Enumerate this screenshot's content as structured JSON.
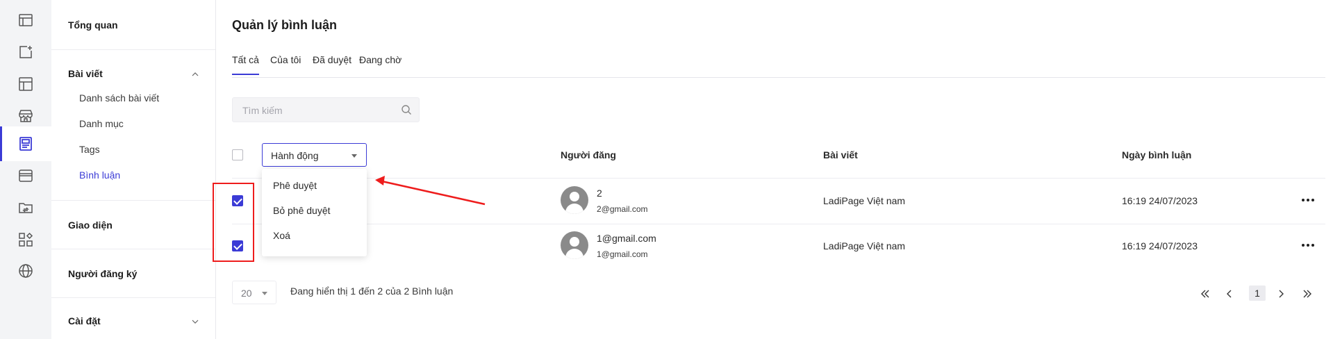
{
  "accent_color": "#3b3bd6",
  "rail": {
    "items": [
      {
        "icon": "dashboard-icon"
      },
      {
        "icon": "add-post-icon"
      },
      {
        "icon": "layout-icon"
      },
      {
        "icon": "store-icon"
      },
      {
        "icon": "blog-icon",
        "active": true
      },
      {
        "icon": "browser-icon"
      },
      {
        "icon": "folder-sync-icon"
      },
      {
        "icon": "apps-icon"
      },
      {
        "icon": "globe-icon"
      }
    ]
  },
  "sidebar": {
    "overview": "Tổng quan",
    "posts": "Bài viết",
    "post_items": [
      "Danh sách bài viết",
      "Danh mục",
      "Tags",
      "Bình luận"
    ],
    "theme": "Giao diện",
    "subscribers": "Người đăng ký",
    "settings": "Cài đặt"
  },
  "main": {
    "title": "Quản lý bình luận",
    "tabs": [
      "Tất cả",
      "Của tôi",
      "Đã duyệt",
      "Đang chờ"
    ],
    "search_placeholder": "Tìm kiếm",
    "action_label": "Hành động",
    "columns": {
      "author": "Người đăng",
      "post": "Bài viết",
      "date": "Ngày bình luận"
    },
    "rows": [
      {
        "name": "2",
        "email": "2@gmail.com",
        "post": "LadiPage Việt nam",
        "date": "16:19 24/07/2023",
        "checked": true
      },
      {
        "name": "1@gmail.com",
        "email": "1@gmail.com",
        "post": "LadiPage Việt nam",
        "date": "16:19 24/07/2023",
        "checked": true
      }
    ],
    "action_menu": [
      "Phê duyệt",
      "Bỏ phê duyệt",
      "Xoá"
    ],
    "page_size": "20",
    "showing_text": "Đang hiển thị 1 đến 2 của 2 Bình luận",
    "current_page": "1"
  },
  "annotation_color": "#ee1c1c"
}
